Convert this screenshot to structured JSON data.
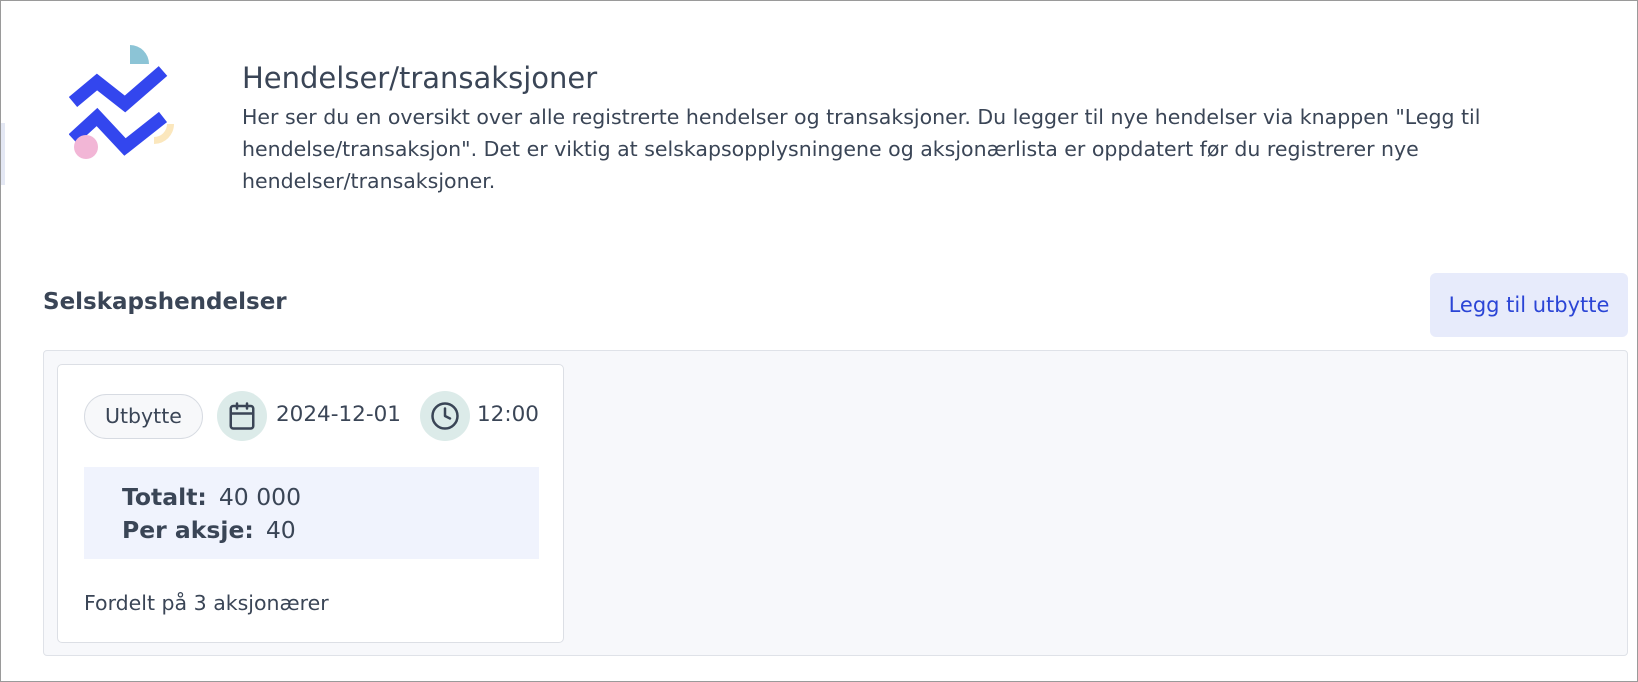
{
  "header": {
    "title": "Hendelser/transaksjoner",
    "description": "Her ser du en oversikt over alle registrerte hendelser og transaksjoner. Du legger til nye hendelser via knappen \"Legg til hendelse/transaksjon\". Det er viktig at selskapsopplysningene og aksjonærlista er oppdatert før du registrerer nye hendelser/transaksjoner."
  },
  "section": {
    "title": "Selskapshendelser",
    "add_button_label": "Legg til utbytte"
  },
  "events": [
    {
      "type": "Utbytte",
      "date": "2024-12-01",
      "time": "12:00",
      "total_label": "Totalt:",
      "total_value": "40 000",
      "per_share_label": "Per aksje:",
      "per_share_value": "40",
      "distribution_text": "Fordelt på 3 aksjonærer"
    }
  ],
  "icons": {
    "logo": "zigzag-logo-icon",
    "date": "calendar-icon",
    "time": "clock-icon"
  },
  "colors": {
    "accent": "#2b45d6",
    "logo_blue": "#3346ee",
    "logo_teal": "#8cc4d6",
    "logo_pink": "#f2b6d6",
    "logo_yellow": "#fbe7bd",
    "button_bg": "#e7ebfb",
    "icon_circle_bg": "#dcebe9",
    "amount_box_bg": "#f0f3fd"
  }
}
